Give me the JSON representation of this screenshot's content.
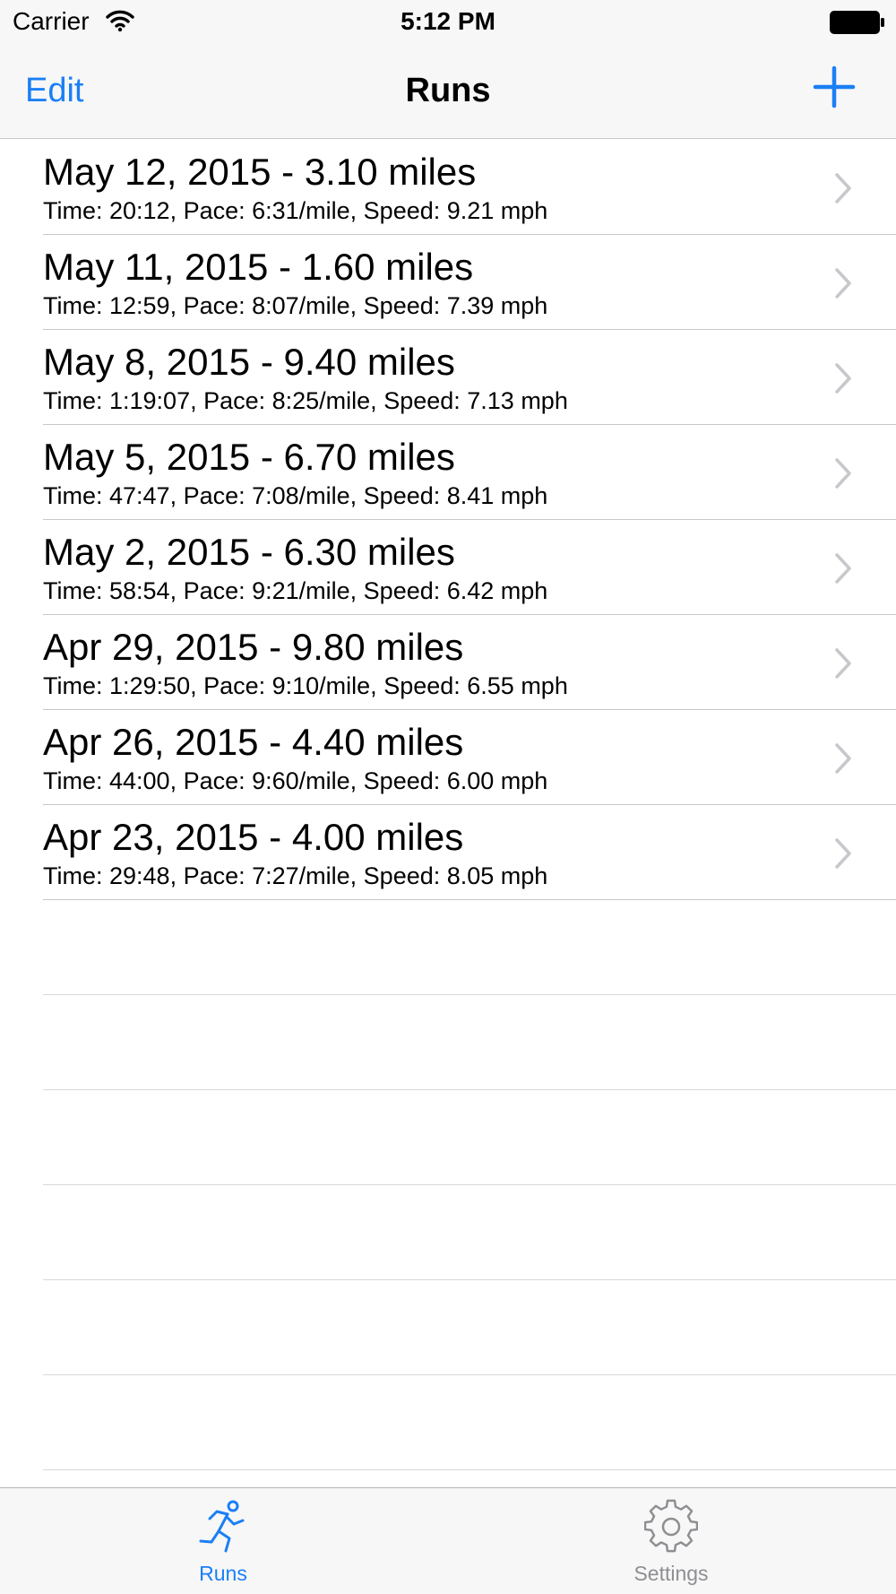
{
  "status_bar": {
    "carrier": "Carrier",
    "time": "5:12 PM",
    "icons": [
      "wifi-icon",
      "battery-icon"
    ]
  },
  "nav_bar": {
    "left_button": "Edit",
    "title": "Runs",
    "right_icon": "add-icon"
  },
  "runs": [
    {
      "title": "May 12, 2015 - 3.10 miles",
      "subtitle": "Time: 20:12, Pace: 6:31/mile, Speed: 9.21 mph"
    },
    {
      "title": "May 11, 2015 - 1.60 miles",
      "subtitle": "Time: 12:59, Pace: 8:07/mile, Speed: 7.39 mph"
    },
    {
      "title": "May 8, 2015 - 9.40 miles",
      "subtitle": "Time: 1:19:07, Pace: 8:25/mile, Speed: 7.13 mph"
    },
    {
      "title": "May 5, 2015 - 6.70 miles",
      "subtitle": "Time: 47:47, Pace: 7:08/mile, Speed: 8.41 mph"
    },
    {
      "title": "May 2, 2015 - 6.30 miles",
      "subtitle": "Time: 58:54, Pace: 9:21/mile, Speed: 6.42 mph"
    },
    {
      "title": "Apr 29, 2015 - 9.80 miles",
      "subtitle": "Time: 1:29:50, Pace: 9:10/mile, Speed: 6.55 mph"
    },
    {
      "title": "Apr 26, 2015 - 4.40 miles",
      "subtitle": "Time: 44:00, Pace: 9:60/mile, Speed: 6.00 mph"
    },
    {
      "title": "Apr 23, 2015 - 4.00 miles",
      "subtitle": "Time: 29:48, Pace: 7:27/mile, Speed: 8.05 mph"
    }
  ],
  "tab_bar": {
    "tabs": [
      {
        "label": "Runs",
        "icon": "runner-icon",
        "selected": true
      },
      {
        "label": "Settings",
        "icon": "gear-icon",
        "selected": false
      }
    ]
  },
  "colors": {
    "accent": "#1b7ff5",
    "inactive": "#8e8e93",
    "bar_background": "#f7f7f7",
    "separator": "#c8c7cc"
  }
}
